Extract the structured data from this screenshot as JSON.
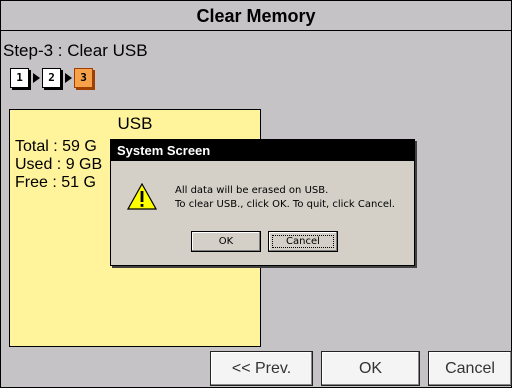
{
  "header": {
    "title": "Clear Memory"
  },
  "step": {
    "label": "Step-3 : Clear USB",
    "boxes": [
      "1",
      "2",
      "3"
    ],
    "active_index": 3,
    "active_color": "#f7a24a"
  },
  "usb_panel": {
    "title": "USB",
    "total": "Total : 59 G",
    "used": "Used : 9 GB",
    "free": "Free  : 51 G",
    "background": "#fff39c"
  },
  "footer": {
    "prev_label": "<< Prev.",
    "ok_label": "OK",
    "cancel_label": "Cancel"
  },
  "dialog": {
    "title": "System Screen",
    "icon": "warning-icon",
    "message_line1": "All data will be erased on USB.",
    "message_line2": "To clear USB., click OK. To quit, click Cancel.",
    "ok_label": "OK",
    "cancel_label": "Cancel"
  }
}
